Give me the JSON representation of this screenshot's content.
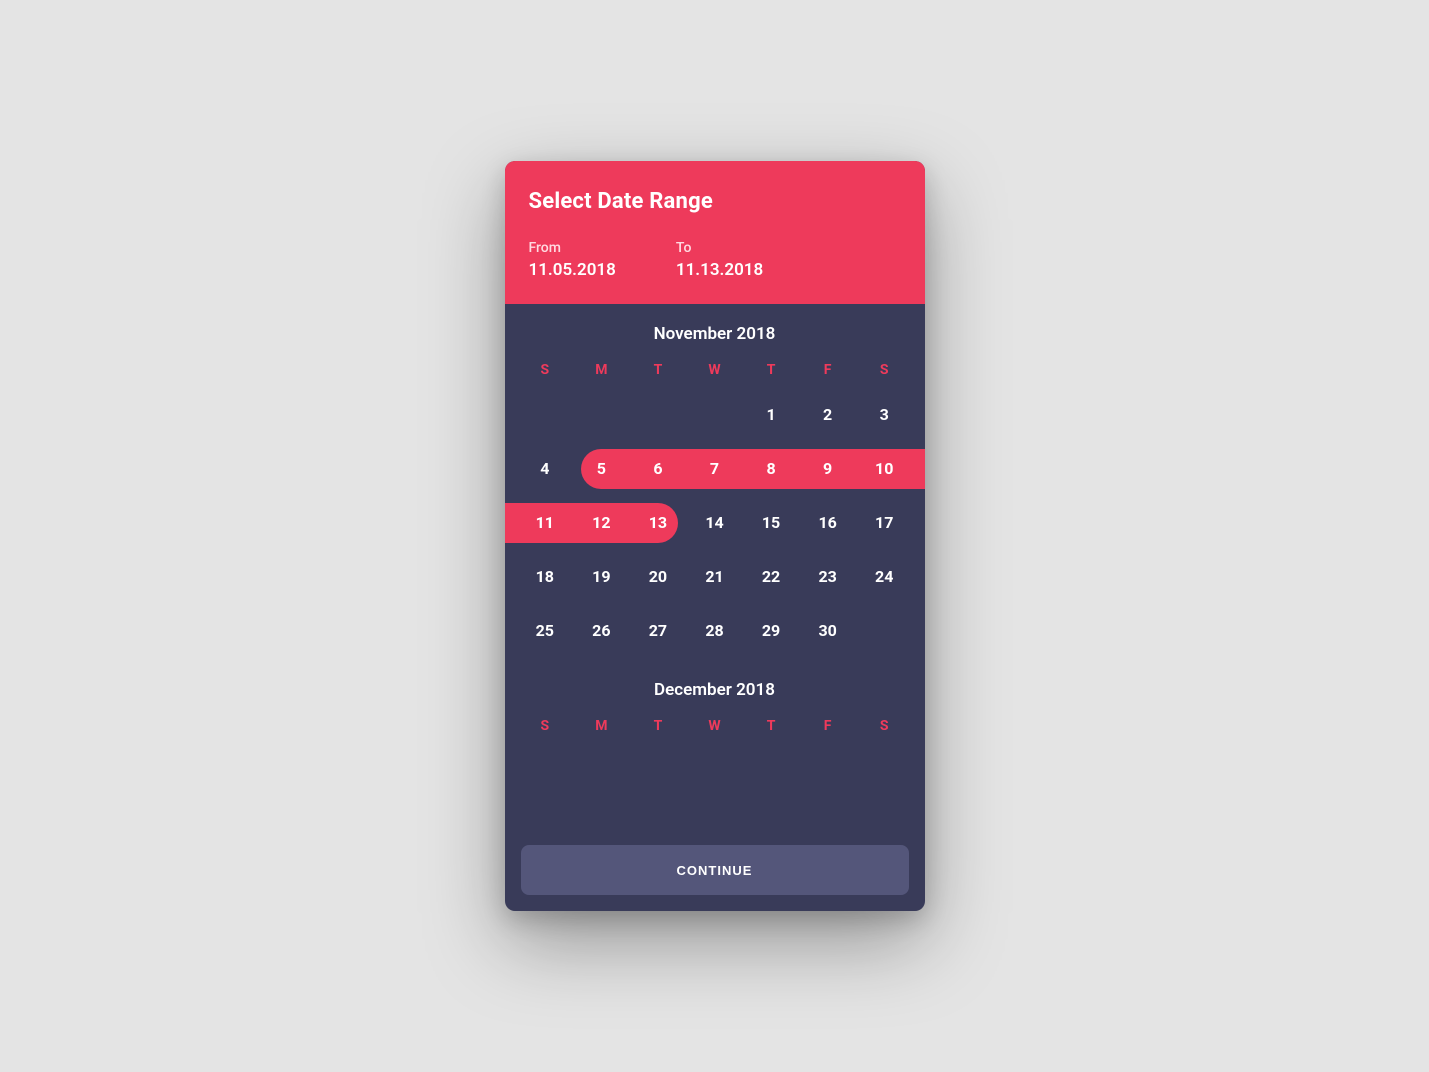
{
  "colors": {
    "accent": "#ee3a5b",
    "card": "#393b59",
    "button": "#54567a",
    "bg": "#e4e4e4"
  },
  "header": {
    "title": "Select Date Range",
    "from_label": "From",
    "from_value": "11.05.2018",
    "to_label": "To",
    "to_value": "11.13.2018"
  },
  "dow": [
    "S",
    "M",
    "T",
    "W",
    "T",
    "F",
    "S"
  ],
  "months": {
    "nov": {
      "title": "November 2018",
      "weeks": [
        [
          "",
          "",
          "",
          "",
          "1",
          "2",
          "3"
        ],
        [
          "4",
          "5",
          "6",
          "7",
          "8",
          "9",
          "10"
        ],
        [
          "11",
          "12",
          "13",
          "14",
          "15",
          "16",
          "17"
        ],
        [
          "18",
          "19",
          "20",
          "21",
          "22",
          "23",
          "24"
        ],
        [
          "25",
          "26",
          "27",
          "28",
          "29",
          "30",
          ""
        ]
      ],
      "selected_start": 5,
      "selected_end": 13
    },
    "dec": {
      "title": "December 2018"
    }
  },
  "footer": {
    "continue_label": "CONTINUE"
  }
}
